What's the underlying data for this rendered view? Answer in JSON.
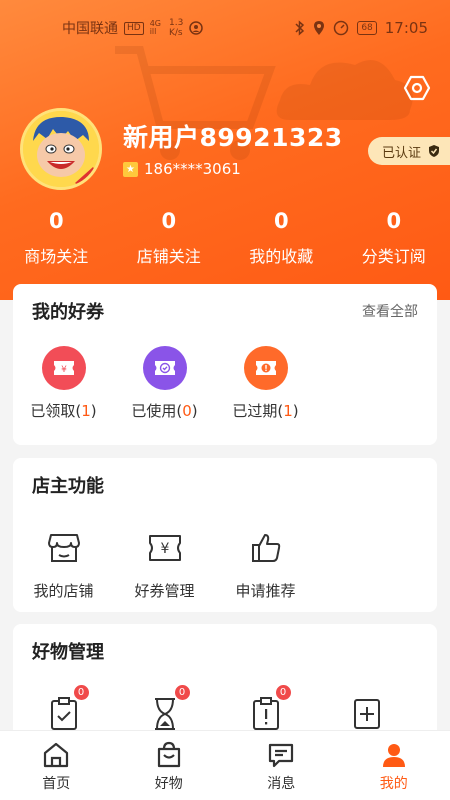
{
  "status_bar": {
    "carrier": "中国联通",
    "hd": "HD",
    "net_top": "4G",
    "net_bottom": "ill",
    "speed_value": "1.3",
    "speed_unit": "K/s",
    "battery": "68",
    "time": "17:05"
  },
  "profile": {
    "username": "新用户89921323",
    "phone": "186****3061",
    "verified_label": "已认证"
  },
  "stats": [
    {
      "value": "0",
      "label": "商场关注"
    },
    {
      "value": "0",
      "label": "店铺关注"
    },
    {
      "value": "0",
      "label": "我的收藏"
    },
    {
      "value": "0",
      "label": "分类订阅"
    }
  ],
  "coupons": {
    "title": "我的好券",
    "more": "查看全部",
    "items": [
      {
        "label": "已领取(",
        "count": "1",
        "close": ")",
        "color": "#f24d57",
        "icon": "yuan-ticket-icon"
      },
      {
        "label": "已使用(",
        "count": "0",
        "close": ")",
        "color": "#8a54e8",
        "icon": "check-ticket-icon"
      },
      {
        "label": "已过期(",
        "count": "1",
        "close": ")",
        "color": "#ff6a2a",
        "icon": "alert-ticket-icon"
      }
    ]
  },
  "shop": {
    "title": "店主功能",
    "items": [
      {
        "label": "我的店铺",
        "icon": "store-icon"
      },
      {
        "label": "好券管理",
        "icon": "coupon-manage-icon"
      },
      {
        "label": "申请推荐",
        "icon": "thumbs-up-icon"
      }
    ]
  },
  "goods": {
    "title": "好物管理",
    "items": [
      {
        "badge": "0",
        "icon": "clipboard-check-icon"
      },
      {
        "badge": "0",
        "icon": "hourglass-icon"
      },
      {
        "badge": "0",
        "icon": "clipboard-alert-icon"
      },
      {
        "icon": "add-box-icon"
      }
    ]
  },
  "nav": [
    {
      "label": "首页",
      "icon": "home-icon"
    },
    {
      "label": "好物",
      "icon": "bag-icon"
    },
    {
      "label": "消息",
      "icon": "message-icon"
    },
    {
      "label": "我的",
      "icon": "user-icon",
      "active": true
    }
  ],
  "colors": {
    "brand": "#ff5a14",
    "gold": "#fde6b8"
  }
}
